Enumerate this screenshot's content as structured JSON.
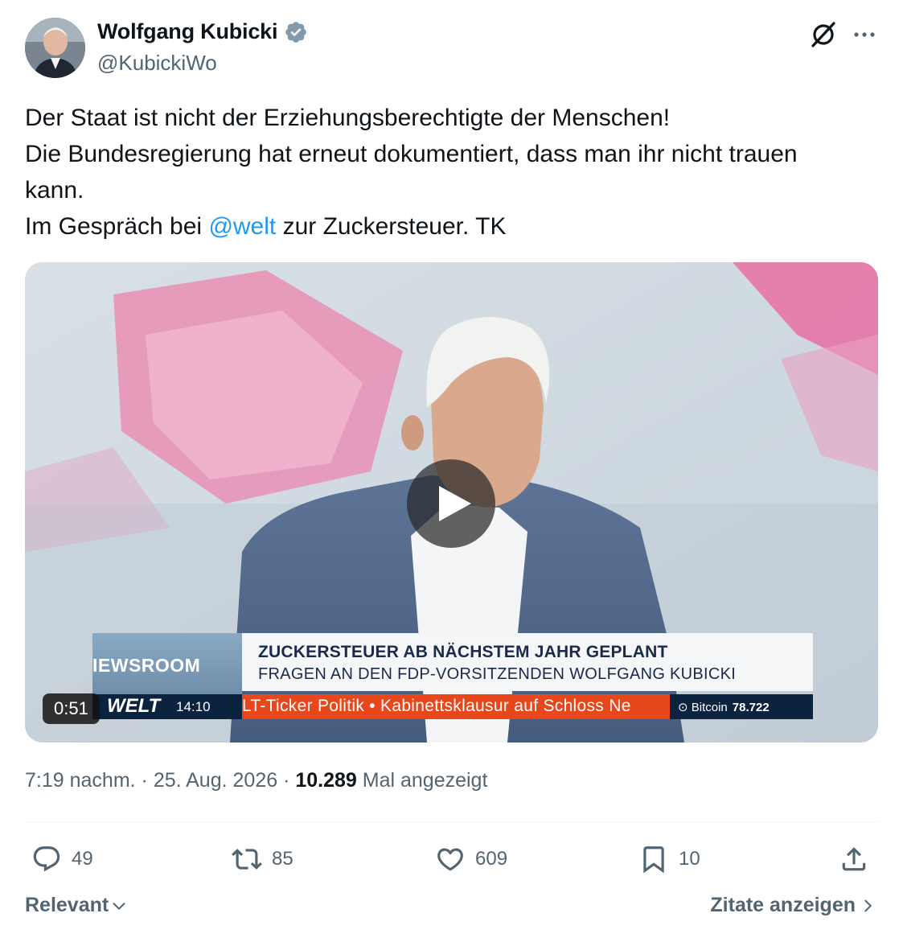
{
  "author": {
    "name": "Wolfgang Kubicki",
    "handle": "@KubickiWo",
    "verified": true
  },
  "tweet": {
    "line1": "Der Staat ist nicht der Erziehungsberechtigte der Menschen!",
    "line2": "Die Bundesregierung hat erneut dokumentiert, dass man ihr nicht trauen",
    "line3": "kann.",
    "line4_prefix": "Im Gespräch bei ",
    "line4_mention": "@welt",
    "line4_suffix": " zur Zuckersteuer. TK"
  },
  "video": {
    "duration": "0:51",
    "overlay": {
      "headline": "ZUCKERSTEUER AB NÄCHSTEM JAHR GEPLANT",
      "subheadline": "FRAGEN AN DEN FDP-VORSITZENDEN WOLFGANG KUBICKI",
      "program": "IEWSROOM",
      "channel": "WELT",
      "time": "14:10",
      "ticker": "LT-Ticker Politik  • Kabinettsklausur auf Schloss Ne",
      "bitcoin_label": "Bitcoin",
      "bitcoin_value": "78.722"
    }
  },
  "meta": {
    "time": "7:19 nachm.",
    "separator": " · ",
    "date": "25. Aug. 2026",
    "views": "10.289",
    "views_label": " Mal angezeigt"
  },
  "stats": {
    "replies": "49",
    "retweets": "85",
    "likes": "609",
    "bookmarks": "10"
  },
  "footer": {
    "sort_label": "Relevant",
    "quotes_label": "Zitate anzeigen"
  },
  "colors": {
    "accent": "#1d9bf0",
    "text": "#0f1419",
    "secondary": "#536471",
    "ticker_red": "#e8471b",
    "ticker_navy": "#0c2340"
  }
}
